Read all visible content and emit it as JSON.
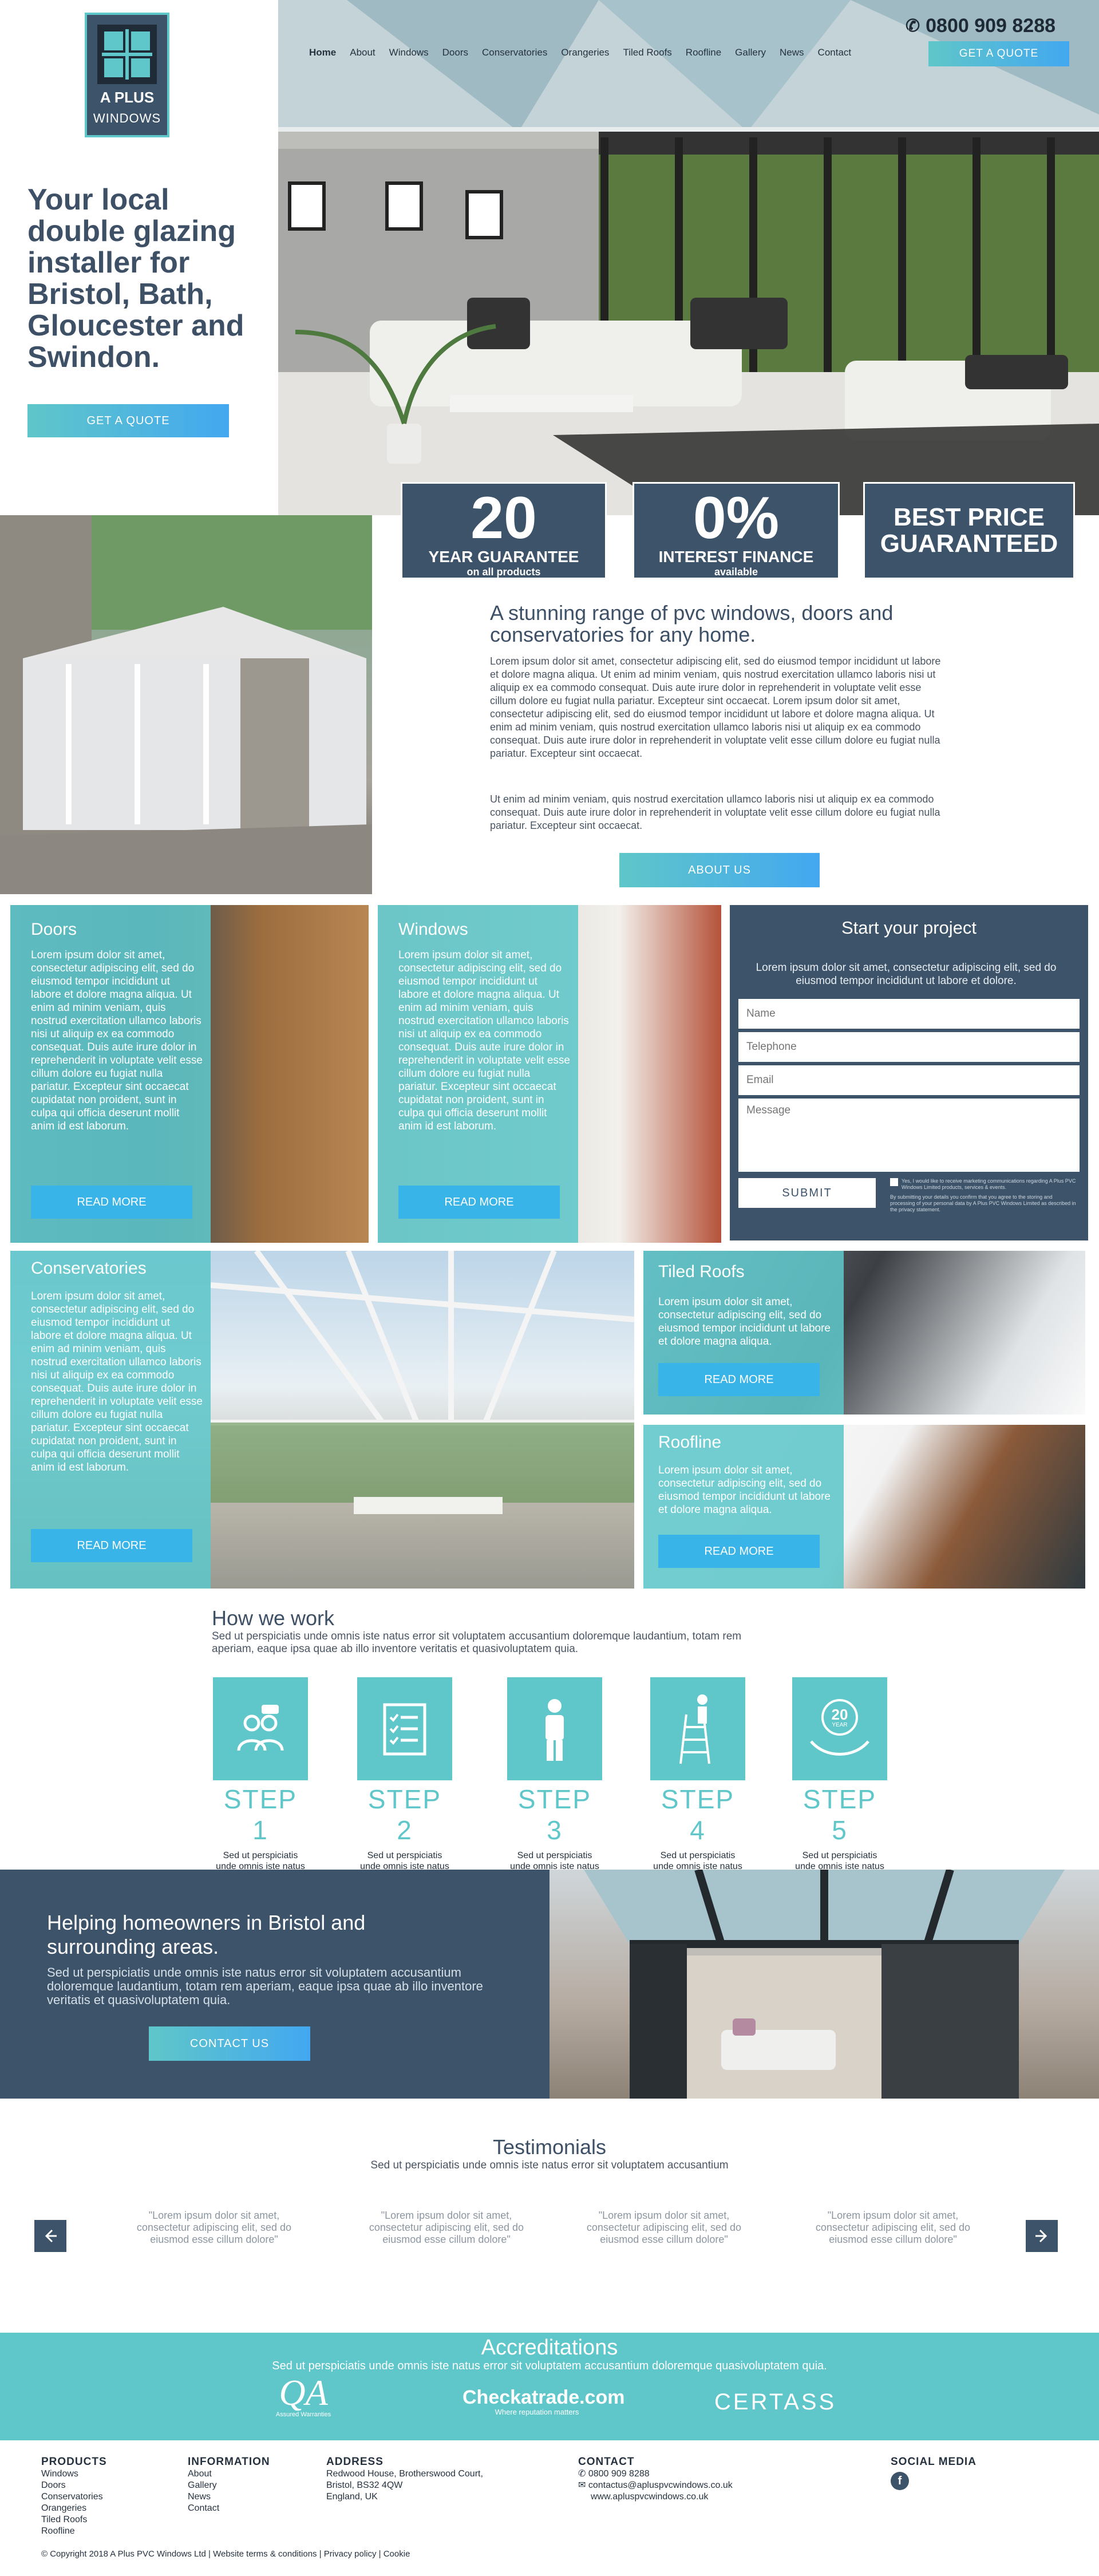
{
  "brand": {
    "line1": "A PLUS",
    "line2": "WINDOWS"
  },
  "header": {
    "phone": "0800 909 8288",
    "quote_label": "GET A QUOTE",
    "nav": [
      "Home",
      "About",
      "Windows",
      "Doors",
      "Conservatories",
      "Orangeries",
      "Tiled Roofs",
      "Roofline",
      "Gallery",
      "News",
      "Contact"
    ]
  },
  "hero": {
    "title": "Your local double glazing installer for Bristol, Bath, Gloucester and Swindon.",
    "cta": "GET A QUOTE"
  },
  "stats": [
    {
      "big": "20",
      "l1": "YEAR GUARANTEE",
      "l2": "on all products"
    },
    {
      "big": "0%",
      "l1": "INTEREST FINANCE",
      "l2": "available"
    },
    {
      "big": "",
      "l1": "BEST PRICE",
      "l2": "GUARANTEED"
    }
  ],
  "about": {
    "heading": "A stunning range of pvc windows, doors and conservatories for any home.",
    "p1": "Lorem ipsum dolor sit amet, consectetur adipiscing elit, sed do eiusmod tempor incididunt ut labore et dolore magna aliqua. Ut enim ad minim veniam, quis nostrud exercitation ullamco laboris nisi ut aliquip ex ea commodo consequat. Duis aute irure dolor in reprehenderit in voluptate velit esse cillum dolore eu fugiat nulla pariatur. Excepteur sint occaecat. Lorem ipsum dolor sit amet, consectetur adipiscing elit, sed do eiusmod tempor incididunt ut labore et dolore magna aliqua. Ut enim ad minim veniam, quis nostrud exercitation ullamco laboris nisi ut aliquip ex ea commodo consequat. Duis aute irure dolor in reprehenderit in voluptate velit esse cillum dolore eu fugiat nulla pariatur. Excepteur sint occaecat.",
    "p2": "Ut enim ad minim veniam, quis nostrud exercitation ullamco laboris nisi ut aliquip ex ea commodo consequat. Duis aute irure dolor in reprehenderit in voluptate velit esse cillum dolore eu fugiat nulla pariatur. Excepteur sint occaecat.",
    "cta": "ABOUT US"
  },
  "tiles": {
    "doors": {
      "title": "Doors",
      "text": "Lorem ipsum dolor sit amet, consectetur adipiscing elit, sed do eiusmod tempor incididunt ut labore et dolore magna aliqua. Ut enim ad minim veniam, quis nostrud exercitation ullamco laboris nisi ut aliquip ex ea commodo consequat. Duis aute irure dolor in reprehenderit in voluptate velit esse cillum dolore eu fugiat nulla pariatur. Excepteur sint occaecat cupidatat non proident, sunt in culpa qui officia deserunt mollit anim id est laborum.",
      "cta": "READ MORE"
    },
    "windows": {
      "title": "Windows",
      "text": "Lorem ipsum dolor sit amet, consectetur adipiscing elit, sed do eiusmod tempor incididunt ut labore et dolore magna aliqua. Ut enim ad minim veniam, quis nostrud exercitation ullamco laboris nisi ut aliquip ex ea commodo consequat. Duis aute irure dolor in reprehenderit in voluptate velit esse cillum dolore eu fugiat nulla pariatur. Excepteur sint occaecat cupidatat non proident, sunt in culpa qui officia deserunt mollit anim id est laborum.",
      "cta": "READ MORE"
    },
    "conservatories": {
      "title": "Conservatories",
      "text": "Lorem ipsum dolor sit amet, consectetur adipiscing elit, sed do eiusmod tempor incididunt ut labore et dolore magna aliqua. Ut enim ad minim veniam, quis nostrud exercitation ullamco laboris nisi ut aliquip ex ea commodo consequat. Duis aute irure dolor in reprehenderit in voluptate velit esse cillum dolore eu fugiat nulla pariatur. Excepteur sint occaecat cupidatat non proident, sunt in culpa qui officia deserunt mollit anim id est laborum.",
      "cta": "READ MORE"
    },
    "tiled": {
      "title": "Tiled Roofs",
      "text": "Lorem ipsum dolor sit amet, consectetur adipiscing elit, sed do eiusmod tempor incididunt ut labore et dolore magna aliqua.",
      "cta": "READ MORE"
    },
    "roofline": {
      "title": "Roofline",
      "text": "Lorem ipsum dolor sit amet, consectetur adipiscing elit, sed do eiusmod tempor incididunt ut labore et dolore magna aliqua.",
      "cta": "READ MORE"
    }
  },
  "form": {
    "title": "Start your project",
    "text": "Lorem ipsum dolor sit amet, consectetur adipiscing elit, sed do eiusmod tempor incididunt ut labore et dolore.",
    "name_ph": "Name",
    "tel_ph": "Telephone",
    "email_ph": "Email",
    "msg_ph": "Message",
    "submit": "SUBMIT",
    "consent": "Yes, I would like to receive marketing communications regarding A Plus PVC Windows Limited products, services & events.",
    "privacy": "By submitting your details you confirm that you agree to the storing and processing of your personal data by A Plus PVC Windows Limited as described in the privacy statement."
  },
  "how": {
    "title": "How we work",
    "sub": "Sed ut perspiciatis unde omnis iste natus error sit voluptatem accusantium doloremque laudantium, totam rem aperiam, eaque ipsa quae ab illo inventore veritatis et quasivoluptatem quia.",
    "steps": [
      {
        "label": "STEP 1",
        "desc": "Sed ut perspiciatis unde omnis iste natus error sit voluptatem",
        "icon": "consultation-icon"
      },
      {
        "label": "STEP 2",
        "desc": "Sed ut perspiciatis unde omnis iste natus error sit voluptatem",
        "icon": "checklist-icon"
      },
      {
        "label": "STEP 3",
        "desc": "Sed ut perspiciatis unde omnis iste natus error sit voluptatem",
        "icon": "installer-icon"
      },
      {
        "label": "STEP 4",
        "desc": "Sed ut perspiciatis unde omnis iste natus error sit voluptatem",
        "icon": "ladder-icon"
      },
      {
        "label": "STEP 5",
        "desc": "Sed ut perspiciatis unde omnis iste natus error sit voluptatem",
        "icon": "guarantee-icon",
        "badge": "20",
        "badge_sub": "YEAR"
      }
    ]
  },
  "helping": {
    "title": "Helping homeowners in Bristol and surrounding areas.",
    "sub": "Sed ut perspiciatis unde omnis iste natus error sit voluptatem accusantium doloremque laudantium, totam rem aperiam, eaque ipsa quae ab illo inventore veritatis et quasivoluptatem quia.",
    "cta": "CONTACT US"
  },
  "testimonials": {
    "title": "Testimonials",
    "sub": "Sed ut perspiciatis unde omnis iste natus error sit voluptatem accusantium",
    "quotes": [
      "\"Lorem ipsum dolor sit amet, consectetur adipiscing elit, sed do eiusmod esse cillum dolore\"",
      "\"Lorem ipsum dolor sit amet, consectetur adipiscing elit, sed do eiusmod esse cillum dolore\"",
      "\"Lorem ipsum dolor sit amet, consectetur adipiscing elit, sed do eiusmod esse cillum dolore\"",
      "\"Lorem ipsum dolor sit amet, consectetur adipiscing elit, sed do eiusmod esse cillum dolore\""
    ]
  },
  "accreditations": {
    "title": "Accreditations",
    "sub": "Sed ut perspiciatis unde omnis iste natus error sit voluptatem accusantium doloremque quasivoluptatem quia.",
    "qa": "QA",
    "qa_sub": "Assured Warranties",
    "checka": "Checkatrade.com",
    "checka_sub": "Where reputation matters",
    "certass": "CERTASS"
  },
  "footer": {
    "products_head": "PRODUCTS",
    "products": [
      "Windows",
      "Doors",
      "Conservatories",
      "Orangeries",
      "Tiled Roofs",
      "Roofline"
    ],
    "info_head": "INFORMATION",
    "info": [
      "About",
      "Gallery",
      "News",
      "Contact"
    ],
    "address_head": "ADDRESS",
    "address": [
      "Redwood House, Brotherswood Court,",
      "Bristol, BS32 4QW",
      "England, UK"
    ],
    "contact_head": "CONTACT",
    "phone": "0800 909 8288",
    "email": "contactus@apluspvcwindows.co.uk",
    "web": "www.apluspvcwindows.co.uk",
    "social_head": "SOCIAL MEDIA",
    "facebook": "f",
    "copyright": "© Copyright 2018 A Plus PVC Windows Ltd | Website terms & conditions | Privacy policy | Cookie"
  },
  "colors": {
    "teal": "#5fc6c9",
    "navy": "#3d536a",
    "blue": "#43a8f0"
  }
}
